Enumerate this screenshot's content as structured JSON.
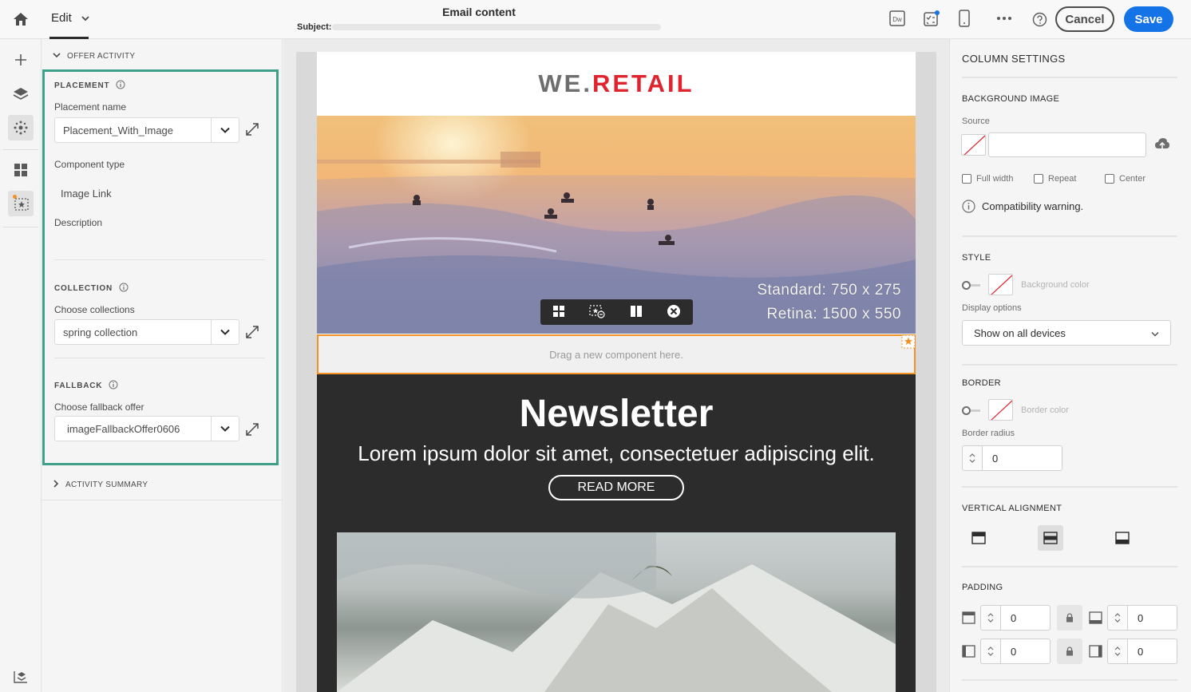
{
  "topbar": {
    "edit_label": "Edit",
    "email_title": "Email content",
    "subject_label": "Subject:",
    "cancel_label": "Cancel",
    "save_label": "Save",
    "dw_label": "Dw"
  },
  "left_panel": {
    "offer_activity_label": "OFFER ACTIVITY",
    "placement": {
      "title": "PLACEMENT",
      "name_label": "Placement name",
      "name_value": "Placement_With_Image",
      "component_type_label": "Component type",
      "component_type_value": "Image Link",
      "description_label": "Description"
    },
    "collection": {
      "title": "COLLECTION",
      "choose_label": "Choose collections",
      "value": "spring collection"
    },
    "fallback": {
      "title": "FALLBACK",
      "choose_label": "Choose fallback offer",
      "value": "imageFallbackOffer0606"
    },
    "activity_summary_label": "ACTIVITY SUMMARY"
  },
  "canvas": {
    "logo_prefix": "WE.",
    "logo_suffix": "RETAIL",
    "hero_dim_standard": "Standard: 750 x 275",
    "hero_dim_retina": "Retina: 1500 x 550",
    "dropzone_text": "Drag a new component here.",
    "newsletter_title": "Newsletter",
    "newsletter_subtitle": "Lorem ipsum dolor sit amet, consectetuer adipiscing elit.",
    "read_more_label": "READ MORE"
  },
  "right_panel": {
    "title": "COLUMN SETTINGS",
    "background_image": {
      "title": "BACKGROUND IMAGE",
      "source_label": "Source",
      "full_width_label": "Full width",
      "repeat_label": "Repeat",
      "center_label": "Center",
      "compat_warning": "Compatibility warning."
    },
    "style": {
      "title": "STYLE",
      "background_color_label": "Background color",
      "display_options_label": "Display options",
      "display_options_value": "Show on all devices"
    },
    "border": {
      "title": "BORDER",
      "border_color_label": "Border color",
      "border_radius_label": "Border radius",
      "border_radius_value": "0"
    },
    "vertical_alignment": {
      "title": "VERTICAL ALIGNMENT"
    },
    "padding": {
      "title": "PADDING",
      "top": "0",
      "bottom": "0",
      "left": "0",
      "right": "0"
    }
  },
  "colors": {
    "accent_blue": "#1473e6",
    "highlight_green": "#3fa08a",
    "dropzone_orange": "#f39224",
    "logo_red": "#e0242f",
    "logo_grey": "#6e6e6e"
  }
}
